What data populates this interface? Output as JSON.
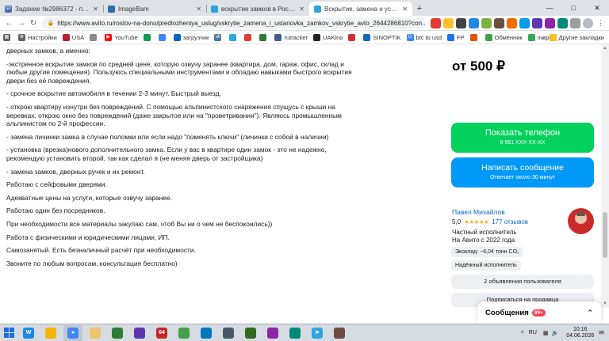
{
  "browser": {
    "tabs": [
      {
        "title": "Задание №2986372 - просмотр з",
        "color": "#4a6fb0",
        "glyph": "SP"
      },
      {
        "title": "ImageBam",
        "color": "#2b6cb0",
        "glyph": ""
      },
      {
        "title": "вскрытие замков в Ростове-на-Д",
        "color": "#2ba4e0",
        "glyph": ""
      },
      {
        "title": "Вскрытие, замена и установка за",
        "color": "#2ba4e0",
        "glyph": ""
      }
    ],
    "new_tab": "+",
    "url": "https://www.avito.ru/rostov-na-donu/predlozheniya_uslug/vskrytie_zamena_i_ustanovka_zamkov_vskrytie_avto_2644286810?con...",
    "bookmarks": [
      {
        "label": "Настройки",
        "color": "#5f6368",
        "glyph": "⚙"
      },
      {
        "label": "USA",
        "color": "#b22234",
        "glyph": ""
      },
      {
        "label": "",
        "color": "#8a8a8a",
        "glyph": ""
      },
      {
        "label": "YouTube",
        "color": "#ff0000",
        "glyph": "▶"
      },
      {
        "label": "",
        "color": "#0f9d58",
        "glyph": ""
      },
      {
        "label": "",
        "color": "#4285f4",
        "glyph": ""
      },
      {
        "label": "загрузчик",
        "color": "#0a66c2",
        "glyph": ""
      },
      {
        "label": "",
        "color": "#4c75a3",
        "glyph": "vk"
      },
      {
        "label": "",
        "color": "#2ca5e0",
        "glyph": ""
      },
      {
        "label": "",
        "color": "#e53935",
        "glyph": ""
      },
      {
        "label": "",
        "color": "#2e7d32",
        "glyph": ""
      },
      {
        "label": "rutracker",
        "color": "#3f5f8f",
        "glyph": ""
      },
      {
        "label": "UAKino",
        "color": "#222222",
        "glyph": ""
      },
      {
        "label": "",
        "color": "#d32f2f",
        "glyph": ""
      },
      {
        "label": "SINOPTIK",
        "color": "#1565c0",
        "glyph": ""
      },
      {
        "label": "btc to usd",
        "color": "#4285f4",
        "glyph": "G"
      },
      {
        "label": "FP",
        "color": "#1a73e8",
        "glyph": ""
      },
      {
        "label": "",
        "color": "#e65100",
        "glyph": ""
      },
      {
        "label": "Обменник",
        "color": "#43a047",
        "glyph": ""
      },
      {
        "label": "maps",
        "color": "#34a853",
        "glyph": ""
      }
    ],
    "bookmarks_other": "Другие закладки"
  },
  "description": {
    "intro_tail": "дверных замков, а именно:",
    "paragraphs": [
      "-экстренное вскрытие замков по средней цене, которую озвучу заранее (квартира, дом, гараж, офис, склад и любые другие помещения). Пользуюсь специальными инструментами и обладаю навыками быстрого вскрытия двери без её повреждения.",
      "- срочное вскрытие автомобиля в течении 2-3 минут. Быстрый выезд.",
      "- открою квартиру изнутри без повреждений. С помощью альпинистского снаряжения спущусь с крыши на веревках, открою окно без повреждений (даже закрытое или на \"проветривании\"). Являюсь промышленным альпинистом по 2-й профессии.",
      "- замена личинки замка в случае поломки или если надо \"поменять ключи\" (личинки с собой в наличии)",
      "- установка (врезка)нового дополнительного замка. Если у вас в квартире один замок - это не надежно, рекомендую установить второй, так как сделал я (не меняя дверь от застройщика)",
      "- замена замков, дверных ручек и их ремонт.",
      "Работаю с сейфовыми дверями.",
      "Адекватные цены на услуги, которые озвучу заранее.",
      "Работаю один без посредников.",
      "При необходимости все материалы закупаю сам, чтоб Вы ни о чем не беспокоились))",
      "Работа с физическими и юридическими лицами, ИП.",
      "Самозанятый. Есть безналичный расчёт при необходимости.",
      "Звоните по любым вопросам, консультация бесплатно)"
    ]
  },
  "sidebar": {
    "price": "от 500 ₽",
    "phone_button": {
      "label": "Показать телефон",
      "sub": "8 961 XXX-XX-XX"
    },
    "message_button": {
      "label": "Написать сообщение",
      "sub": "Отвечает около 30 минут"
    },
    "seller": {
      "name": "Павел Михайлов",
      "rating": "5,0",
      "stars": "★★★★★",
      "reviews": "177 отзывов",
      "type": "Частный исполнитель",
      "since": "На Авито с 2022 года"
    },
    "eco_badge": "Экоклад: ~6,04 тонн CO₂",
    "reliable_badge": "Надёжный исполнитель",
    "ads_button": "2 объявления пользователя",
    "subscribe_button": "Подписаться на продавца"
  },
  "messages_popup": {
    "label": "Сообщения",
    "badge": "99+"
  },
  "taskbar": {
    "apps": [
      {
        "color": "#1e88e5",
        "glyph": "W",
        "active": false
      },
      {
        "color": "#f4b400",
        "glyph": "",
        "active": false
      },
      {
        "color": "#4285f4",
        "glyph": "●",
        "active": true
      },
      {
        "color": "#f0c36d",
        "glyph": "",
        "active": false
      },
      {
        "color": "#2e7d32",
        "glyph": "",
        "active": false
      },
      {
        "color": "#5e35b1",
        "glyph": "",
        "active": false
      },
      {
        "color": "#c62828",
        "glyph": "64",
        "active": false
      },
      {
        "color": "#43a047",
        "glyph": "",
        "active": false
      },
      {
        "color": "#0277bd",
        "glyph": "",
        "active": false
      },
      {
        "color": "#455a64",
        "glyph": "",
        "active": false
      },
      {
        "color": "#33691e",
        "glyph": "",
        "active": false
      },
      {
        "color": "#8e24aa",
        "glyph": "",
        "active": false
      },
      {
        "color": "#00897b",
        "glyph": "",
        "active": false
      },
      {
        "color": "#2ca5e0",
        "glyph": "➤",
        "active": false
      },
      {
        "color": "#6d4c41",
        "glyph": "",
        "active": false
      }
    ],
    "language": "RU",
    "time": "10:16",
    "date": "04.06.2026"
  }
}
